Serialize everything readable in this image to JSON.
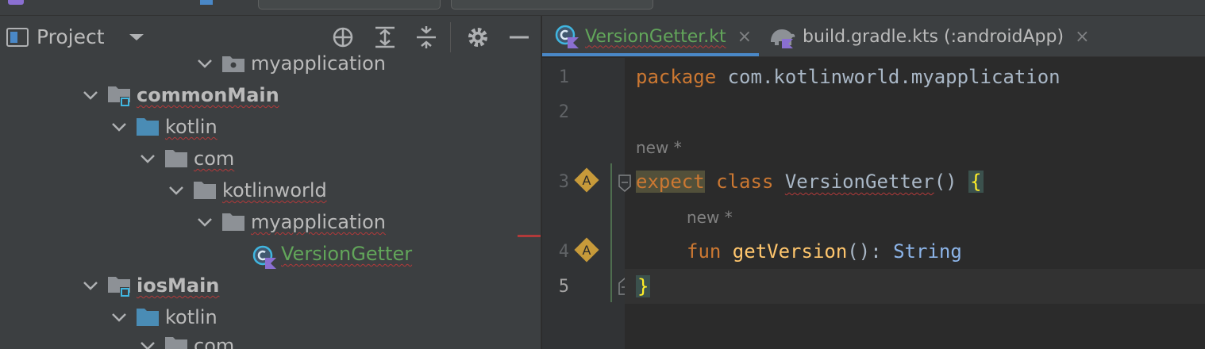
{
  "project_panel": {
    "title": "Project",
    "tree": [
      {
        "label": "myapplication",
        "depth": 7,
        "type": "package",
        "style": "plain"
      },
      {
        "label": "commonMain",
        "depth": 3,
        "type": "source-root",
        "style": "bold"
      },
      {
        "label": "kotlin",
        "depth": 4,
        "type": "source-folder",
        "style": "normal"
      },
      {
        "label": "com",
        "depth": 5,
        "type": "folder",
        "style": "normal"
      },
      {
        "label": "kotlinworld",
        "depth": 6,
        "type": "folder",
        "style": "normal"
      },
      {
        "label": "myapplication",
        "depth": 7,
        "type": "folder",
        "style": "normal"
      },
      {
        "label": "VersionGetter",
        "depth": 8,
        "type": "kotlin-class",
        "style": "green"
      },
      {
        "label": "iosMain",
        "depth": 3,
        "type": "source-root",
        "style": "bold"
      },
      {
        "label": "kotlin",
        "depth": 4,
        "type": "source-folder",
        "style": "normal"
      },
      {
        "label": "com",
        "depth": 5,
        "type": "folder",
        "style": "plain"
      }
    ]
  },
  "tabs": [
    {
      "label": "VersionGetter.kt",
      "active": true,
      "icon": "kotlin-class-icon",
      "close": "×"
    },
    {
      "label": "build.gradle.kts (:androidApp)",
      "active": false,
      "icon": "gradle-icon",
      "close": "×"
    }
  ],
  "editor": {
    "line_numbers": [
      "1",
      "2",
      "3",
      "4",
      "5"
    ],
    "current_line": "5",
    "lines": {
      "l1_kw": "package",
      "l1_pkg": " com.kotlinworld.myapplication",
      "hint_a": "new *",
      "l3_kw1": "expect",
      "l3_kw2": " class ",
      "l3_cls": "VersionGetter",
      "l3_paren": "() ",
      "l3_brace": "{",
      "hint_b": "new *",
      "l4_kw": "fun ",
      "l4_fn": "getVersion",
      "l4_paren": "(): ",
      "l4_type": "String",
      "l5_brace": "}"
    },
    "override_marker": "A"
  },
  "colors": {
    "keyword": "#cc7832",
    "function": "#ffc66d",
    "type": "#8cb4e8",
    "kotlin_class_label": "#62a65a",
    "selection_accent": "#4a88c7"
  }
}
